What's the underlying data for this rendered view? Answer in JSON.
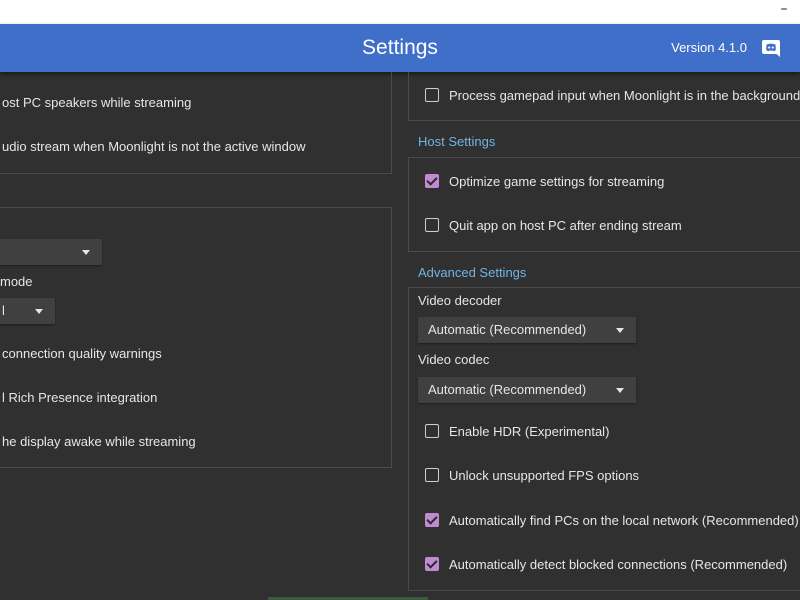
{
  "window": {
    "minimize_glyph": "–"
  },
  "header": {
    "title": "Settings",
    "version": "Version 4.1.0",
    "discord_icon": "discord-icon",
    "accent_color": "#3f6fc9"
  },
  "left": {
    "audio_options": [
      {
        "label": "ost PC speakers while streaming",
        "checked": false
      },
      {
        "label": "udio stream when Moonlight is not the active window",
        "checked": false
      }
    ],
    "ui_panel": {
      "combo1_value": "",
      "mode_label": "mode",
      "combo2_value": "l",
      "options": [
        {
          "label": "connection quality warnings"
        },
        {
          "label": "l Rich Presence integration"
        },
        {
          "label": "he display awake while streaming"
        }
      ]
    }
  },
  "right": {
    "gamepad_option": {
      "label": "Process gamepad input when Moonlight is in the background",
      "checked": false
    },
    "host_settings": {
      "title": "Host Settings",
      "options": [
        {
          "label": "Optimize game settings for streaming",
          "checked": true
        },
        {
          "label": "Quit app on host PC after ending stream",
          "checked": false
        }
      ]
    },
    "advanced_settings": {
      "title": "Advanced Settings",
      "video_decoder_label": "Video decoder",
      "video_decoder_value": "Automatic (Recommended)",
      "video_codec_label": "Video codec",
      "video_codec_value": "Automatic (Recommended)",
      "options": [
        {
          "label": "Enable HDR (Experimental)",
          "checked": false
        },
        {
          "label": "Unlock unsupported FPS options",
          "checked": false
        },
        {
          "label": "Automatically find PCs on the local network (Recommended)",
          "checked": true
        },
        {
          "label": "Automatically detect blocked connections (Recommended)",
          "checked": true
        }
      ]
    }
  },
  "colors": {
    "check_accent": "#c38ad4",
    "section_title": "#71b3e3",
    "background": "#303030"
  }
}
